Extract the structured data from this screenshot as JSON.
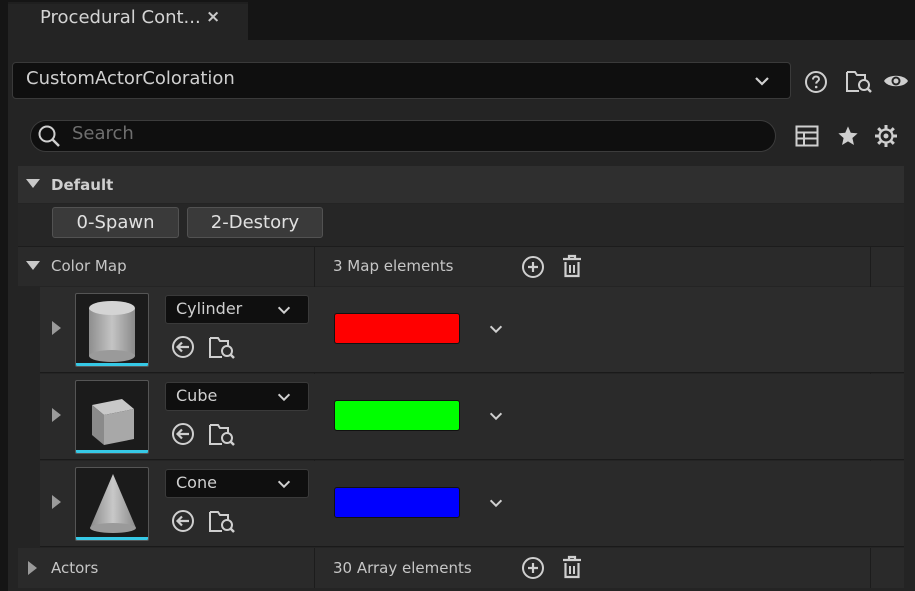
{
  "tab": {
    "title": "Procedural Cont...",
    "close": "×"
  },
  "asset_picker": {
    "value": "CustomActorColoration"
  },
  "search": {
    "placeholder": "Search"
  },
  "default_section": {
    "label": "Default",
    "buttons": [
      "0-Spawn",
      "2-Destory"
    ]
  },
  "color_map": {
    "label": "Color Map",
    "count": "3 Map elements",
    "entries": [
      {
        "mesh": "Cylinder",
        "color": "#ff0000"
      },
      {
        "mesh": "Cube",
        "color": "#00ff00"
      },
      {
        "mesh": "Cone",
        "color": "#0000ff"
      }
    ]
  },
  "actors": {
    "label": "Actors",
    "count": "30 Array elements"
  },
  "colors": {
    "thumb_accent": "#36c9e6"
  }
}
